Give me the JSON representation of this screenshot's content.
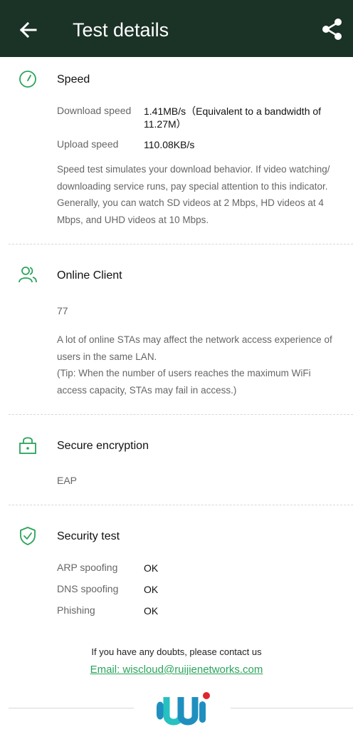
{
  "header": {
    "title": "Test details",
    "back_icon": "arrow-left-icon",
    "share_icon": "share-icon",
    "background_color": "#1b3226"
  },
  "accent_color": "#2aa45b",
  "speed": {
    "icon": "speedometer-icon",
    "title": "Speed",
    "download_label": "Download speed",
    "download_value": "1.41MB/s（Equivalent to a bandwidth of 11.27M）",
    "upload_label": "Upload speed",
    "upload_value": "110.08KB/s",
    "description": "Speed test simulates your download behavior. If video watching/ downloading service runs, pay special attention to this indicator. Generally, you can watch SD videos at 2 Mbps, HD videos at 4 Mbps, and UHD videos at 10 Mbps."
  },
  "online_client": {
    "icon": "users-icon",
    "title": "Online Client",
    "count": "77",
    "description": "A lot of online STAs may affect the network access experience of users in the same LAN.",
    "tip": "(Tip: When the number of users reaches the maximum WiFi access capacity, STAs may fail in access.)"
  },
  "encryption": {
    "icon": "lock-icon",
    "title": "Secure encryption",
    "value": "EAP"
  },
  "security": {
    "icon": "shield-check-icon",
    "title": "Security test",
    "items": [
      {
        "label": "ARP spoofing",
        "value": "OK"
      },
      {
        "label": "DNS spoofing",
        "value": "OK"
      },
      {
        "label": "Phishing",
        "value": "OK"
      }
    ]
  },
  "footer": {
    "contact_text": "If you have any doubts, please contact us",
    "email_text": "Email: wiscloud@ruijienetworks.com",
    "logo_icon": "wi-logo-icon"
  }
}
